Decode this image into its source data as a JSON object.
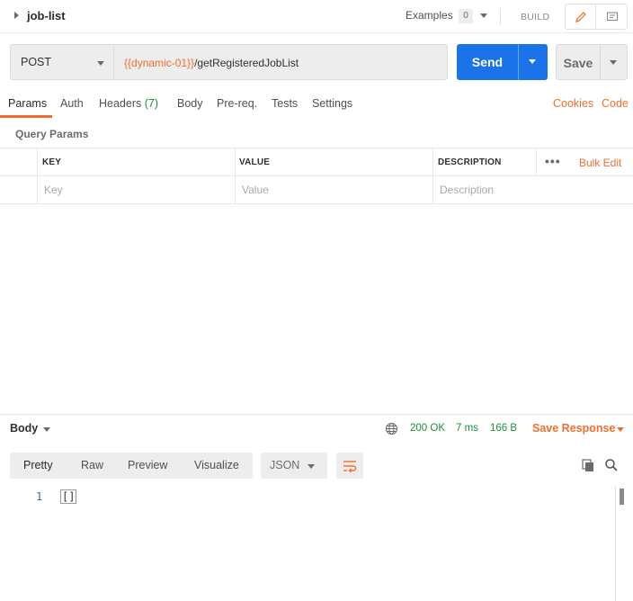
{
  "header": {
    "title": "job-list",
    "examples_label": "Examples",
    "examples_count": "0",
    "build_label": "BUILD"
  },
  "request": {
    "method": "POST",
    "url_variable": "{{dynamic-01}}",
    "url_path": "/getRegisteredJobList",
    "send_label": "Send",
    "save_label": "Save"
  },
  "tabs": {
    "params": "Params",
    "auth": "Auth",
    "headers": "Headers",
    "headers_count": "(7)",
    "body": "Body",
    "prereq": "Pre-req.",
    "tests": "Tests",
    "settings": "Settings",
    "cookies": "Cookies",
    "code": "Code"
  },
  "query_params": {
    "title": "Query Params",
    "columns": [
      "KEY",
      "VALUE",
      "DESCRIPTION"
    ],
    "more": "•••",
    "bulk_edit": "Bulk Edit",
    "placeholders": {
      "key": "Key",
      "value": "Value",
      "description": "Description"
    }
  },
  "response": {
    "body_label": "Body",
    "status": "200 OK",
    "time": "7 ms",
    "size": "166 B",
    "save_response": "Save Response",
    "views": [
      "Pretty",
      "Raw",
      "Preview",
      "Visualize"
    ],
    "active_view": "Pretty",
    "format": "JSON",
    "line_number": "1",
    "content": "[]"
  },
  "colors": {
    "accent": "#f06e2d",
    "primary": "#1a73e8",
    "success": "#1b8f3a"
  }
}
